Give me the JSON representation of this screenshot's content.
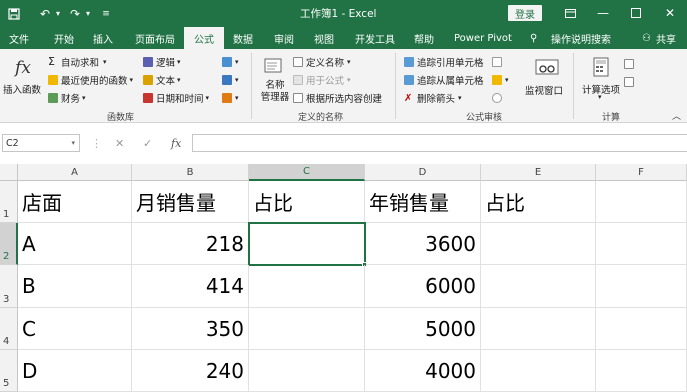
{
  "title_bar": {
    "title": "工作簿1 - Excel",
    "login_label": "登录",
    "save_icon": "save-icon",
    "undo_icon": "undo-icon",
    "redo_icon": "redo-icon",
    "customize_icon": "customize-icon"
  },
  "tabs": [
    {
      "label": "文件"
    },
    {
      "label": "开始"
    },
    {
      "label": "插入"
    },
    {
      "label": "页面布局"
    },
    {
      "label": "公式"
    },
    {
      "label": "数据"
    },
    {
      "label": "审阅"
    },
    {
      "label": "视图"
    },
    {
      "label": "开发工具"
    },
    {
      "label": "帮助"
    },
    {
      "label": "Power Pivot"
    },
    {
      "label": "操作说明搜索"
    },
    {
      "label": "共享"
    }
  ],
  "active_tab": "公式",
  "ribbon": {
    "function_library": {
      "insert_function": "插入函数",
      "autosum": "自动求和",
      "recently_used": "最近使用的函数",
      "financial": "财务",
      "logical": "逻辑",
      "text": "文本",
      "date_time": "日期和时间",
      "group_label": "函数库"
    },
    "defined_names": {
      "name_manager": "名称\n管理器",
      "define_name": "定义名称",
      "use_in_formula": "用于公式",
      "create_from_selection": "根据所选内容创建",
      "group_label": "定义的名称"
    },
    "formula_auditing": {
      "trace_precedents": "追踪引用单元格",
      "trace_dependents": "追踪从属单元格",
      "remove_arrows": "删除箭头",
      "watch_window": "监视窗口",
      "group_label": "公式审核"
    },
    "calculation": {
      "calc_options": "计算选项",
      "group_label": "计算"
    }
  },
  "formula_bar": {
    "name_box": "C2",
    "fx_label": "fx",
    "formula": ""
  },
  "sheet": {
    "columns": [
      "A",
      "B",
      "C",
      "D",
      "E",
      "F"
    ],
    "rows": [
      "1",
      "2",
      "3",
      "4",
      "5"
    ],
    "selected_cell": "C2",
    "cells": [
      [
        "店面",
        "月销售量",
        "占比",
        "年销售量",
        "占比",
        ""
      ],
      [
        "A",
        "218",
        "",
        "3600",
        "",
        ""
      ],
      [
        "B",
        "414",
        "",
        "6000",
        "",
        ""
      ],
      [
        "C",
        "350",
        "",
        "5000",
        "",
        ""
      ],
      [
        "D",
        "240",
        "",
        "4000",
        "",
        ""
      ]
    ]
  },
  "colors": {
    "excel_green": "#217346",
    "ribbon_bg": "#f3f3f3"
  }
}
